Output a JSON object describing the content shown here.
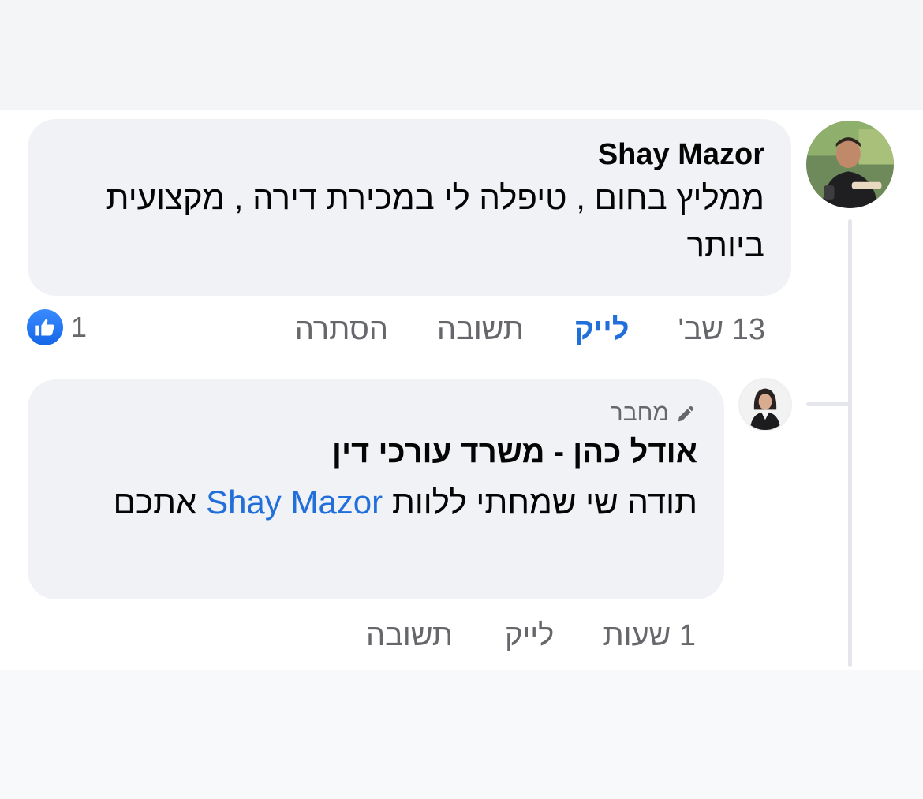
{
  "comments": [
    {
      "author": "Shay Mazor",
      "text": "ממליץ בחום , טיפלה לי במכירת דירה , מקצועית ביותר",
      "time": "13 שב'",
      "like_label": "לייק",
      "reply_label": "תשובה",
      "hide_label": "הסתרה",
      "reaction_count": "1",
      "liked": true
    }
  ],
  "reply": {
    "badge": "מחבר",
    "author": "אודל כהן - משרד עורכי דין",
    "text_prefix": "תודה שי שמחתי ללוות",
    "mention": "Shay Mazor",
    "text_suffix": "אתכם",
    "time": "1 שעות",
    "like_label": "לייק",
    "reply_label": "תשובה"
  },
  "colors": {
    "link": "#216fdb",
    "bubble": "#f0f2f5",
    "muted": "#65676b"
  },
  "icons": {
    "like": "thumbs-up-icon",
    "author_badge": "pencil-icon"
  }
}
